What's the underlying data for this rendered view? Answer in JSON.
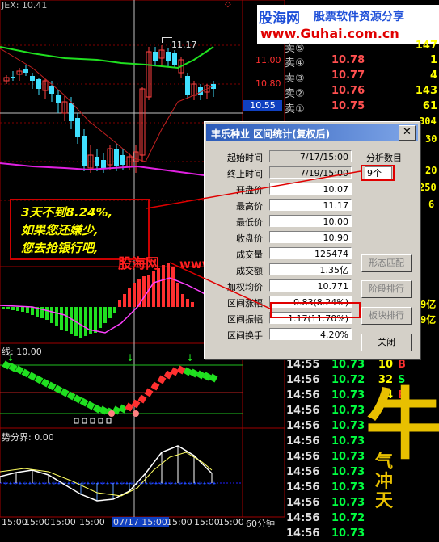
{
  "chart": {
    "title": "JEX: 10.41",
    "price_ticks": [
      "11.00",
      "10.80"
    ],
    "crosshair_price": "10.55",
    "high_label": "11.17",
    "macd_label": "线: 10.00",
    "indicator_label": "势分界: 0.00",
    "time_axis": [
      "15:00",
      "15:00",
      "15:00",
      "15:00",
      "07/17 15:00",
      "15:00",
      "15:00",
      "15:00",
      "15:00",
      "15:00"
    ],
    "period_label": "60分钟"
  },
  "banner": {
    "site_name": "股海网",
    "slogan": "股票软件资源分享",
    "url": "www.Guhai.com.cn"
  },
  "quotes": {
    "asks": [
      {
        "label": "卖⑤",
        "price": "",
        "volume": "147"
      },
      {
        "label": "卖④",
        "price": "10.78",
        "volume": "1"
      },
      {
        "label": "卖③",
        "price": "10.77",
        "volume": "4"
      },
      {
        "label": "卖②",
        "price": "10.76",
        "volume": "143"
      },
      {
        "label": "卖①",
        "price": "10.75",
        "volume": "61"
      }
    ],
    "side_numbers": [
      "304",
      "30",
      "20",
      "250",
      "6",
      "9亿",
      "9亿"
    ],
    "trades": [
      {
        "time": "14:55",
        "price": "10.73",
        "volume": "10",
        "flag": "B"
      },
      {
        "time": "14:56",
        "price": "10.72",
        "volume": "32",
        "flag": "S"
      },
      {
        "time": "14:56",
        "price": "10.73",
        "volume": "4",
        "flag": "B"
      },
      {
        "time": "14:56",
        "price": "10.73",
        "volume": "",
        "flag": ""
      },
      {
        "time": "14:56",
        "price": "10.73",
        "volume": "",
        "flag": ""
      },
      {
        "time": "14:56",
        "price": "10.73",
        "volume": "",
        "flag": ""
      },
      {
        "time": "14:56",
        "price": "10.73",
        "volume": "",
        "flag": ""
      },
      {
        "time": "14:56",
        "price": "10.73",
        "volume": "",
        "flag": ""
      },
      {
        "time": "14:56",
        "price": "10.73",
        "volume": "",
        "flag": ""
      },
      {
        "time": "14:56",
        "price": "10.73",
        "volume": "",
        "flag": ""
      },
      {
        "time": "14:56",
        "price": "10.72",
        "volume": "",
        "flag": ""
      },
      {
        "time": "14:56",
        "price": "10.73",
        "volume": "",
        "flag": ""
      }
    ]
  },
  "dialog": {
    "title": "丰乐种业  区间统计(复权后)",
    "close": "✕",
    "fields": [
      {
        "label": "起始时间",
        "value": "7/17/15:00"
      },
      {
        "label": "终止时间",
        "value": "7/19/15:00"
      },
      {
        "label": "开盘价",
        "value": "10.07"
      },
      {
        "label": "最高价",
        "value": "11.17"
      },
      {
        "label": "最低价",
        "value": "10.00"
      },
      {
        "label": "收盘价",
        "value": "10.90"
      },
      {
        "label": "成交量",
        "value": "125474"
      },
      {
        "label": "成交额",
        "value": "1.35亿"
      },
      {
        "label": "加权均价",
        "value": "10.771"
      },
      {
        "label": "区间涨幅",
        "value": "0.83(8.24%)"
      },
      {
        "label": "区间振幅",
        "value": "1.17(11.70%)"
      },
      {
        "label": "区间换手",
        "value": "4.20%"
      }
    ],
    "analysis_label": "分析数目",
    "analysis_value": "9个",
    "buttons": [
      "形态匹配",
      "阶段排行",
      "板块排行",
      "关闭"
    ]
  },
  "annotation": {
    "line1": "3天不到8.24%,",
    "line2": "如果您还嫌少,",
    "line3": "您去抢银行吧,"
  },
  "watermark": {
    "site": "股海网",
    "url": "www.Guhai.com.cn"
  },
  "logo": {
    "glyph": "牛",
    "text": "气冲天"
  }
}
